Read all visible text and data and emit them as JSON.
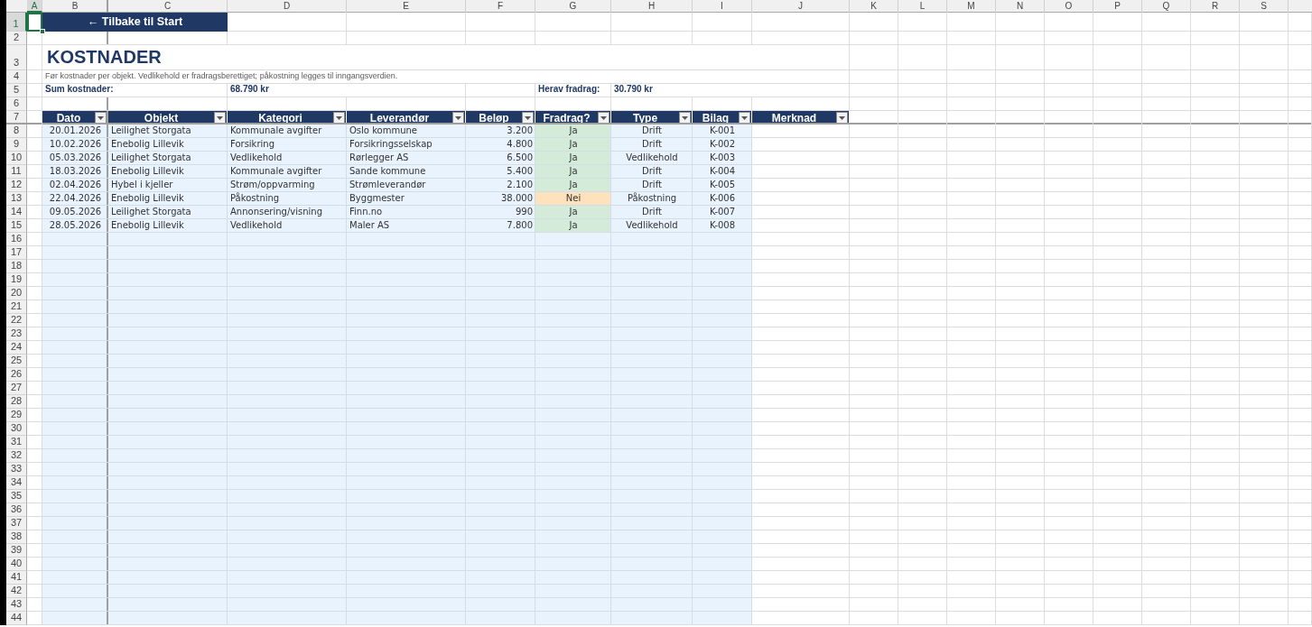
{
  "sheet": {
    "column_letters": [
      {
        "label": "A",
        "selected": true
      },
      {
        "label": "B",
        "selected": false
      },
      {
        "label": "C",
        "selected": false
      },
      {
        "label": "D",
        "selected": false
      },
      {
        "label": "E",
        "selected": false
      },
      {
        "label": "F",
        "selected": false
      },
      {
        "label": "G",
        "selected": false
      },
      {
        "label": "H",
        "selected": false
      },
      {
        "label": "I",
        "selected": false
      },
      {
        "label": "J",
        "selected": false
      },
      {
        "label": "K",
        "selected": false
      },
      {
        "label": "L",
        "selected": false
      },
      {
        "label": "M",
        "selected": false
      },
      {
        "label": "N",
        "selected": false
      },
      {
        "label": "O",
        "selected": false
      },
      {
        "label": "P",
        "selected": false
      },
      {
        "label": "Q",
        "selected": false
      },
      {
        "label": "R",
        "selected": false
      },
      {
        "label": "S",
        "selected": false
      }
    ],
    "row_numbers": [
      {
        "label": "1",
        "selected": true
      },
      {
        "label": "2",
        "selected": false
      },
      {
        "label": "3",
        "selected": false
      },
      {
        "label": "4",
        "selected": false
      },
      {
        "label": "5",
        "selected": false
      },
      {
        "label": "6",
        "selected": false
      },
      {
        "label": "7",
        "selected": false
      },
      {
        "label": "8",
        "selected": false
      },
      {
        "label": "9",
        "selected": false
      },
      {
        "label": "10",
        "selected": false
      },
      {
        "label": "11",
        "selected": false
      },
      {
        "label": "12",
        "selected": false
      },
      {
        "label": "13",
        "selected": false
      },
      {
        "label": "14",
        "selected": false
      },
      {
        "label": "15",
        "selected": false
      },
      {
        "label": "16",
        "selected": false
      },
      {
        "label": "17",
        "selected": false
      },
      {
        "label": "18",
        "selected": false
      },
      {
        "label": "19",
        "selected": false
      },
      {
        "label": "20",
        "selected": false
      },
      {
        "label": "21",
        "selected": false
      },
      {
        "label": "22",
        "selected": false
      },
      {
        "label": "23",
        "selected": false
      },
      {
        "label": "24",
        "selected": false
      },
      {
        "label": "25",
        "selected": false
      },
      {
        "label": "26",
        "selected": false
      },
      {
        "label": "27",
        "selected": false
      },
      {
        "label": "28",
        "selected": false
      },
      {
        "label": "29",
        "selected": false
      },
      {
        "label": "30",
        "selected": false
      },
      {
        "label": "31",
        "selected": false
      },
      {
        "label": "32",
        "selected": false
      },
      {
        "label": "33",
        "selected": false
      },
      {
        "label": "34",
        "selected": false
      },
      {
        "label": "35",
        "selected": false
      },
      {
        "label": "36",
        "selected": false
      },
      {
        "label": "37",
        "selected": false
      },
      {
        "label": "38",
        "selected": false
      },
      {
        "label": "39",
        "selected": false
      },
      {
        "label": "40",
        "selected": false
      },
      {
        "label": "41",
        "selected": false
      },
      {
        "label": "42",
        "selected": false
      },
      {
        "label": "43",
        "selected": false
      },
      {
        "label": "44",
        "selected": false
      }
    ]
  },
  "back_button": {
    "label": "← Tilbake til Start"
  },
  "title": "KOSTNADER",
  "subtitle": "Før kostnader per objekt. Vedlikehold er fradragsberettiget; påkostning legges til inngangsverdien.",
  "summary": [
    {
      "label": "Sum kostnader:",
      "value": "68.790 kr"
    },
    {
      "label": "Herav fradrag:",
      "value": "30.790 kr"
    }
  ],
  "table": {
    "columns": [
      "Dato",
      "Objekt",
      "Kategori",
      "Leverandør",
      "Beløp",
      "Fradrag?",
      "Type",
      "Bilag",
      "Merknad"
    ],
    "rows": [
      {
        "cells": [
          "20.01.2026",
          "Leilighet Storgata",
          "Kommunale avgifter",
          "Oslo kommune",
          "3.200",
          "Ja",
          "Drift",
          "K-001"
        ],
        "deductible": true
      },
      {
        "cells": [
          "10.02.2026",
          "Enebolig Lillevik",
          "Forsikring",
          "Forsikringsselskap",
          "4.800",
          "Ja",
          "Drift",
          "K-002"
        ],
        "deductible": true
      },
      {
        "cells": [
          "05.03.2026",
          "Leilighet Storgata",
          "Vedlikehold",
          "Rørlegger AS",
          "6.500",
          "Ja",
          "Vedlikehold",
          "K-003"
        ],
        "deductible": true
      },
      {
        "cells": [
          "18.03.2026",
          "Enebolig Lillevik",
          "Kommunale avgifter",
          "Sande kommune",
          "5.400",
          "Ja",
          "Drift",
          "K-004"
        ],
        "deductible": true
      },
      {
        "cells": [
          "02.04.2026",
          "Hybel i kjeller",
          "Strøm/oppvarming",
          "Strømleverandør",
          "2.100",
          "Ja",
          "Drift",
          "K-005"
        ],
        "deductible": true
      },
      {
        "cells": [
          "22.04.2026",
          "Enebolig Lillevik",
          "Påkostning",
          "Byggmester",
          "38.000",
          "Nei",
          "Påkostning",
          "K-006"
        ],
        "deductible": false
      },
      {
        "cells": [
          "09.05.2026",
          "Leilighet Storgata",
          "Annonsering/visning",
          "Finn.no",
          "990",
          "Ja",
          "Drift",
          "K-007"
        ],
        "deductible": true
      },
      {
        "cells": [
          "28.05.2026",
          "Enebolig Lillevik",
          "Vedlikehold",
          "Maler AS",
          "7.800",
          "Ja",
          "Vedlikehold",
          "K-008"
        ],
        "deductible": true
      }
    ]
  }
}
